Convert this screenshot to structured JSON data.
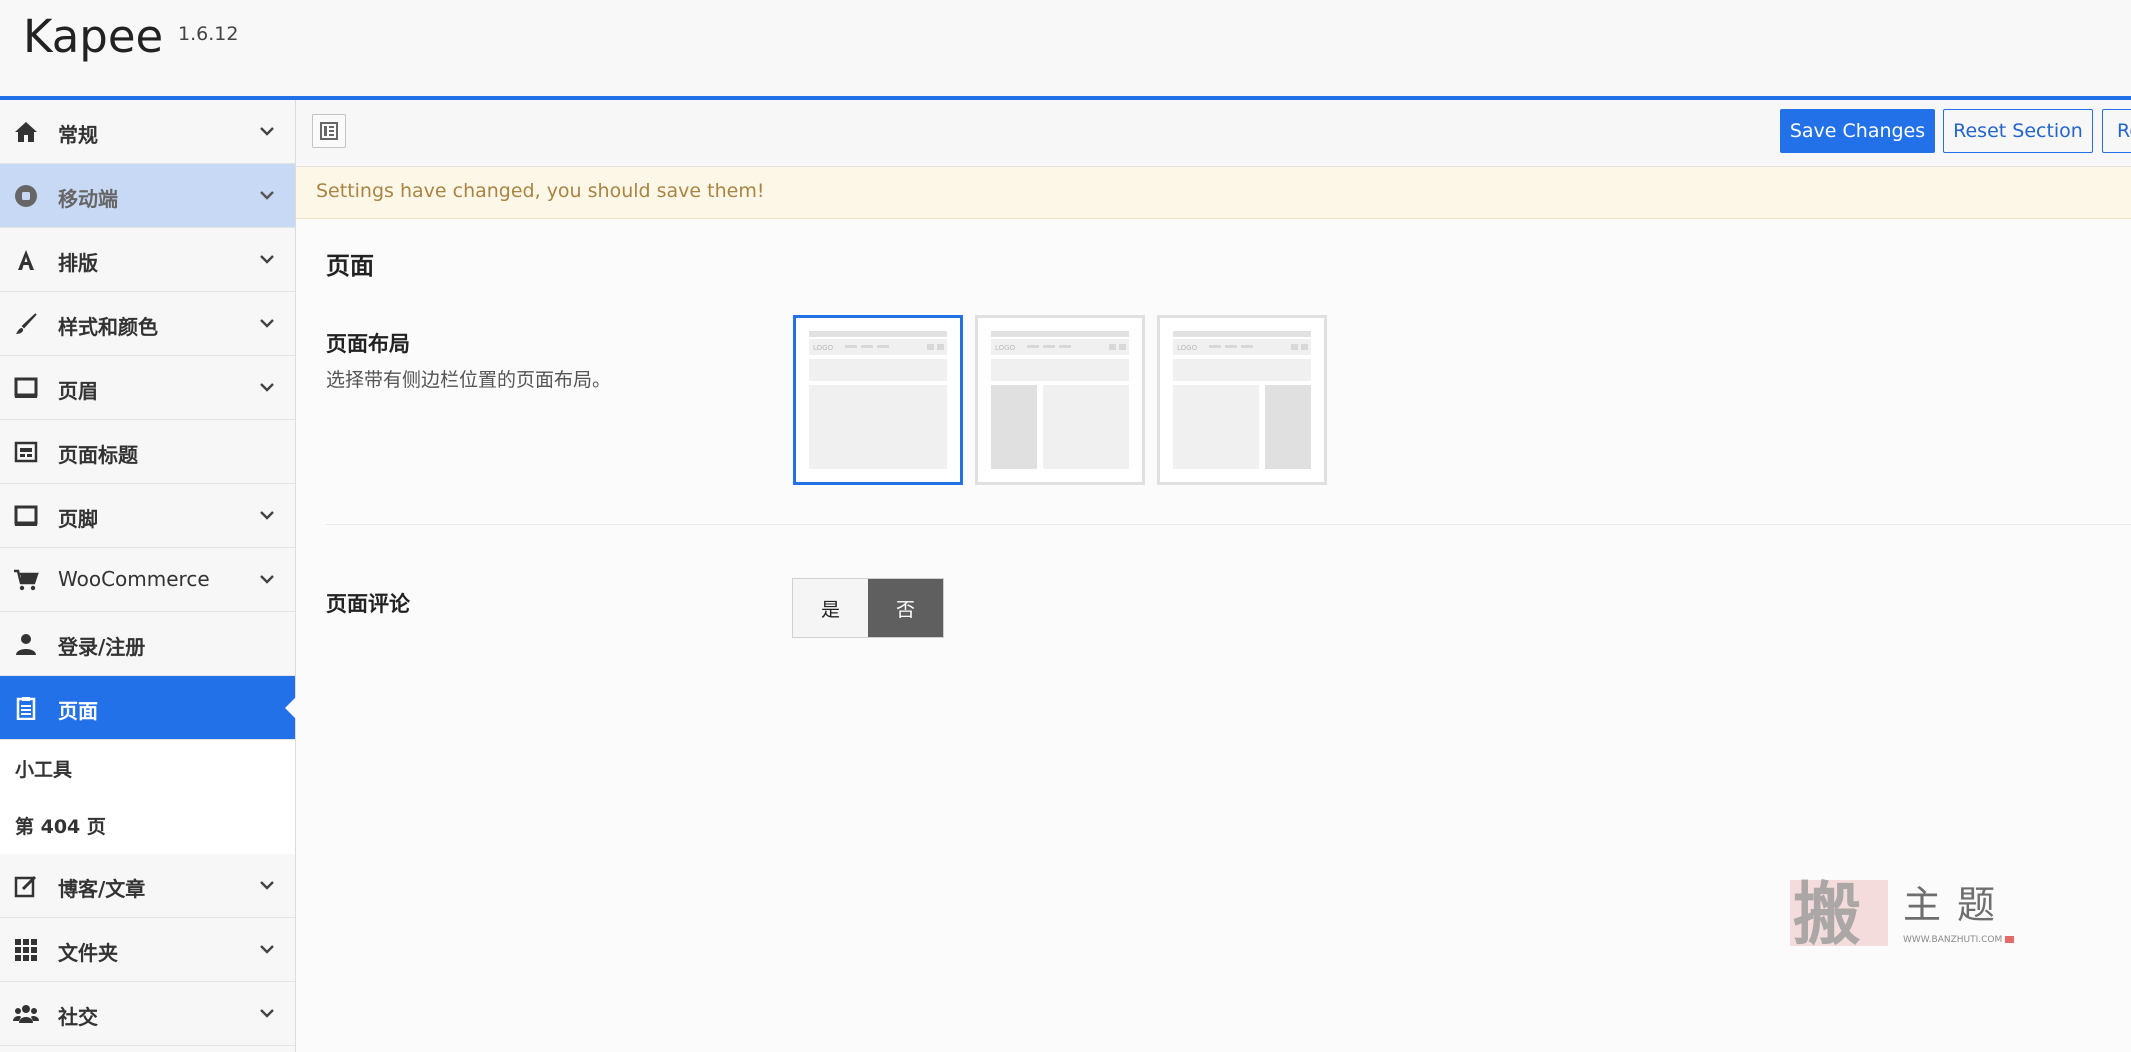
{
  "header": {
    "title": "Kapee",
    "version": "1.6.12"
  },
  "sidebar": {
    "items": [
      {
        "label": "常规",
        "icon": "home-icon",
        "chevron": true
      },
      {
        "label": "移动端",
        "icon": "mobile-icon",
        "chevron": true,
        "state": "hover"
      },
      {
        "label": "排版",
        "icon": "typography-icon",
        "chevron": true
      },
      {
        "label": "样式和颜色",
        "icon": "brush-icon",
        "chevron": true
      },
      {
        "label": "页眉",
        "icon": "header-icon",
        "chevron": true
      },
      {
        "label": "页面标题",
        "icon": "page-title-icon",
        "chevron": false
      },
      {
        "label": "页脚",
        "icon": "footer-icon",
        "chevron": true
      },
      {
        "label": "WooCommerce",
        "icon": "cart-icon",
        "chevron": true
      },
      {
        "label": "登录/注册",
        "icon": "user-icon",
        "chevron": false
      },
      {
        "label": "页面",
        "icon": "clipboard-icon",
        "chevron": false,
        "state": "active"
      }
    ],
    "sub_items": [
      {
        "label": "小工具"
      },
      {
        "label": "第 404 页"
      }
    ],
    "bottom_items": [
      {
        "label": "博客/文章",
        "icon": "edit-icon",
        "chevron": true
      },
      {
        "label": "文件夹",
        "icon": "grid-icon",
        "chevron": true
      },
      {
        "label": "社交",
        "icon": "group-icon",
        "chevron": true
      }
    ]
  },
  "toolbar": {
    "save_label": "Save Changes",
    "reset_section_label": "Reset Section",
    "reset_all_label": "Re"
  },
  "notice": {
    "text": "Settings have changed, you should save them!"
  },
  "main": {
    "section_title": "页面",
    "layout_field": {
      "title": "页面布局",
      "description": "选择带有侧边栏位置的页面布局。",
      "options": [
        {
          "id": "full-width",
          "logo_text": "LOGO",
          "selected": true
        },
        {
          "id": "left-sidebar",
          "logo_text": "LOGO",
          "selected": false
        },
        {
          "id": "right-sidebar",
          "logo_text": "LOGO",
          "selected": false
        }
      ]
    },
    "comments_field": {
      "title": "页面评论",
      "yes_label": "是",
      "no_label": "否",
      "value": "否"
    }
  },
  "watermark": {
    "main": "主题",
    "site": "WWW.BANZHUTI.COM"
  },
  "colors": {
    "accent": "#2271e8",
    "notice_bg": "#fdf7e7",
    "notice_text": "#a98443"
  }
}
